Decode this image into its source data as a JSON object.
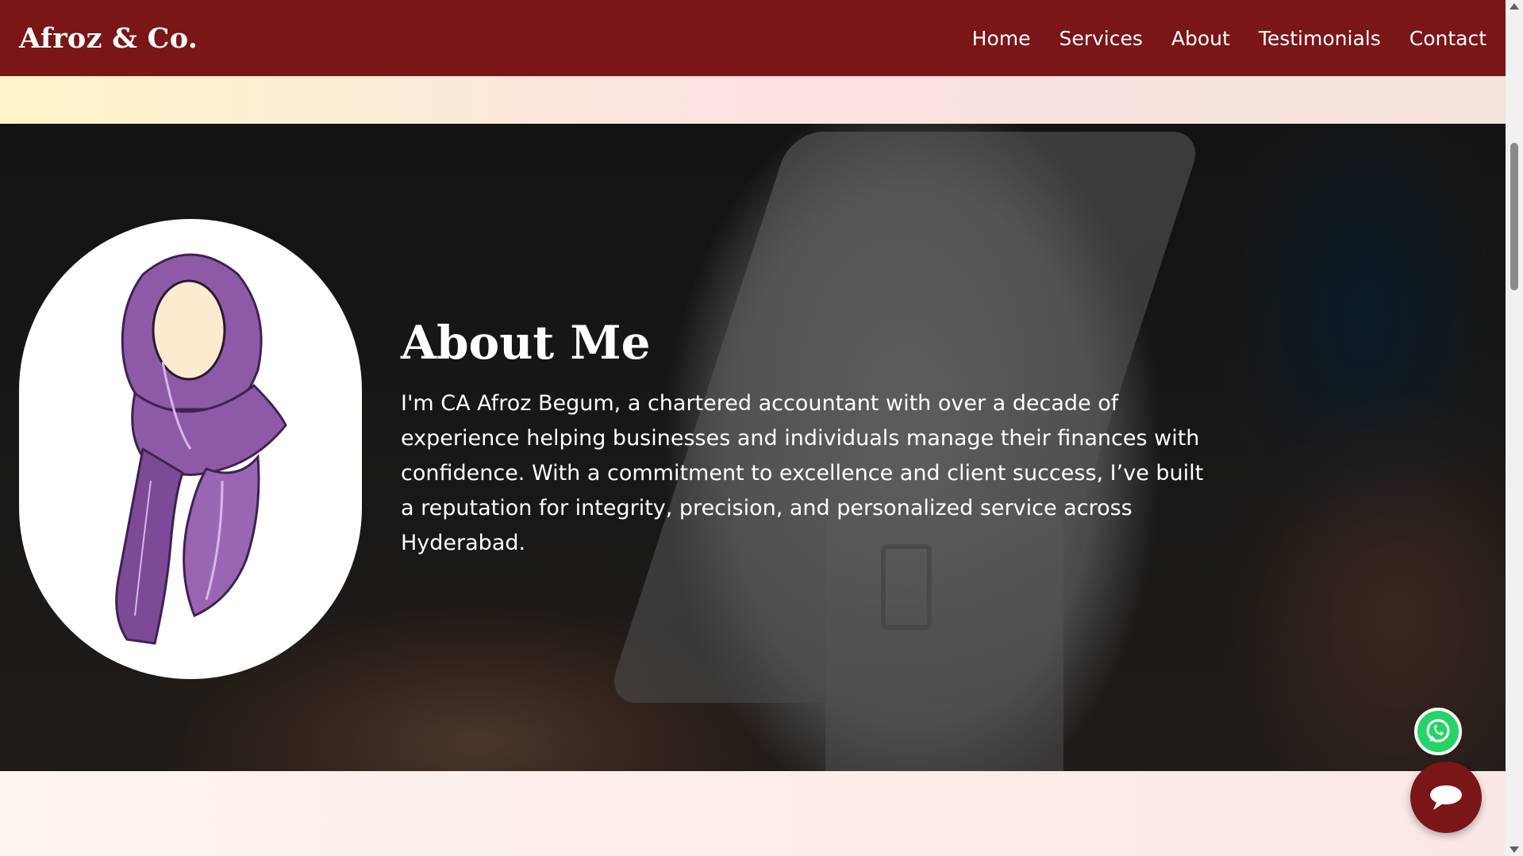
{
  "header": {
    "brand": "Afroz & Co.",
    "nav": [
      "Home",
      "Services",
      "About",
      "Testimonials",
      "Contact"
    ]
  },
  "about": {
    "title": "About Me",
    "body": "I'm CA Afroz Begum, a chartered accountant with over a decade of experience helping businesses and individuals manage their finances with confidence. With a commitment to excellence and client success, I’ve built a reputation for integrity, precision, and personalized service across Hyderabad."
  },
  "floating": {
    "whatsapp_icon": "whatsapp-icon",
    "chat_icon": "chat-bubble-icon"
  },
  "colors": {
    "brand": "#7a1618",
    "whatsapp": "#25d366",
    "hijab": "#8e5aa8"
  }
}
